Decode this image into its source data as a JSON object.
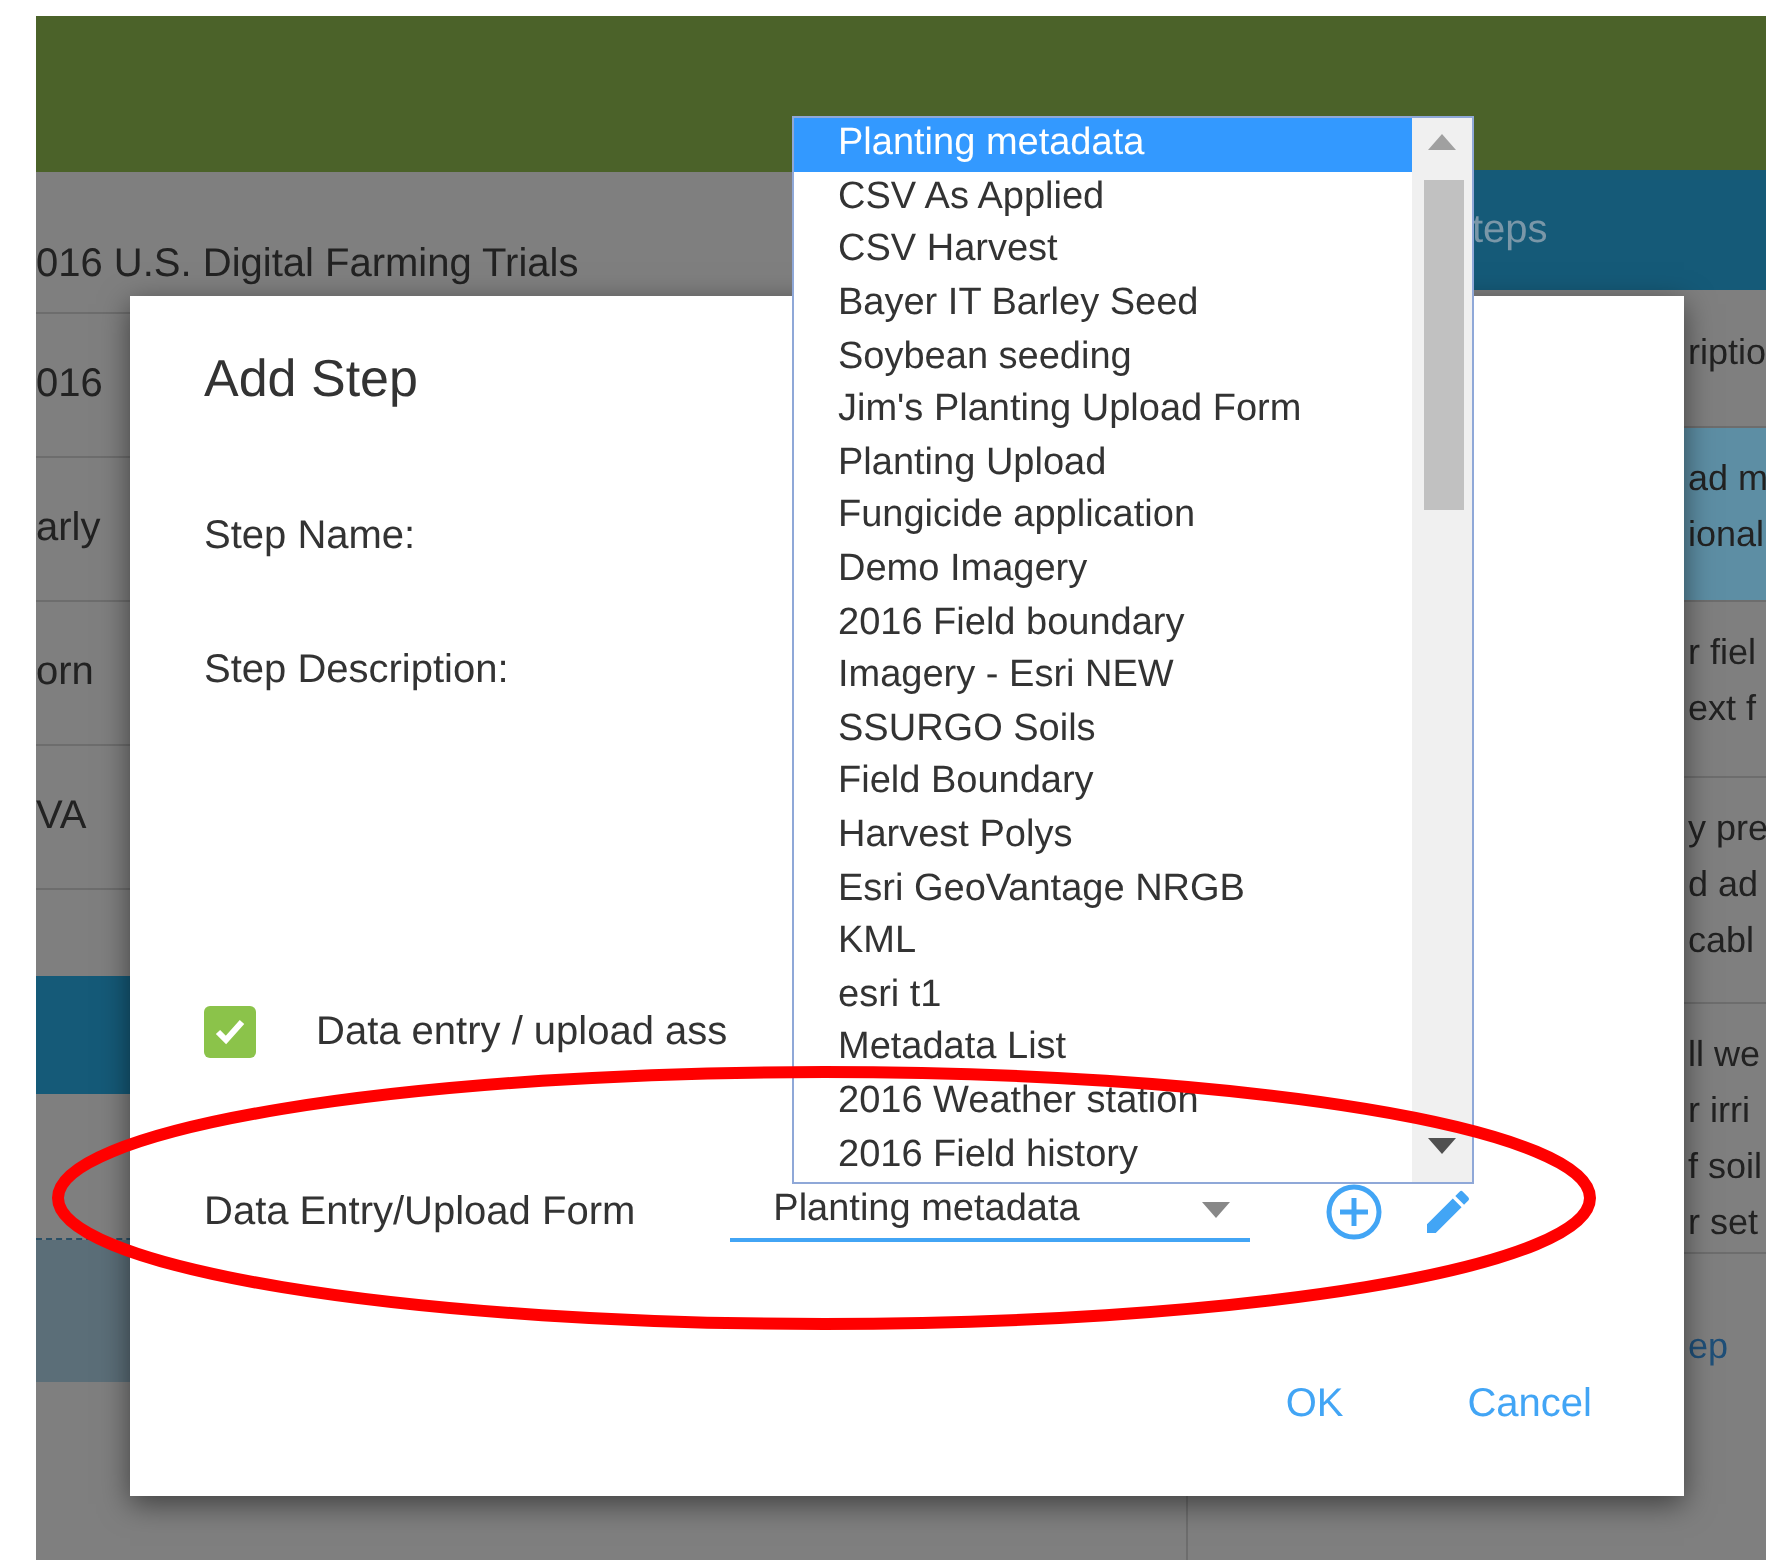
{
  "background_page": {
    "left_panel": {
      "title": "016 U.S. Digital Farming Trials",
      "rows": [
        "016",
        "arly",
        "orn",
        "VA"
      ]
    },
    "right_panel": {
      "header": "teps",
      "rows": [
        {
          "lines": [
            "riptio"
          ],
          "highlighted": false
        },
        {
          "lines": [
            "ad m",
            "ional"
          ],
          "highlighted": true
        },
        {
          "lines": [
            "r fiel",
            "ext f"
          ],
          "highlighted": false
        },
        {
          "lines": [
            "y pre",
            "d ad",
            "cabl"
          ],
          "highlighted": false
        },
        {
          "lines": [
            "ll we",
            "r irri",
            "f soil",
            "r set"
          ],
          "highlighted": false
        }
      ],
      "link": "ep"
    }
  },
  "dialog": {
    "title": "Add Step",
    "fields": [
      {
        "label": "Step Name:"
      },
      {
        "label": "Step Description:"
      }
    ],
    "checkbox": {
      "label": "Data entry / upload ass",
      "checked": true
    },
    "form_select": {
      "label": "Data Entry/Upload Form",
      "value": "Planting metadata"
    },
    "buttons": [
      "OK",
      "Cancel"
    ]
  },
  "dropdown": {
    "options": [
      {
        "label": "Planting metadata",
        "selected": true
      },
      {
        "label": "CSV As Applied",
        "selected": false
      },
      {
        "label": "CSV Harvest",
        "selected": false
      },
      {
        "label": "Bayer IT Barley Seed",
        "selected": false
      },
      {
        "label": "Soybean seeding",
        "selected": false
      },
      {
        "label": "Jim's Planting Upload Form",
        "selected": false
      },
      {
        "label": "Planting Upload",
        "selected": false
      },
      {
        "label": "Fungicide application",
        "selected": false
      },
      {
        "label": "Demo Imagery",
        "selected": false
      },
      {
        "label": "2016 Field boundary",
        "selected": false
      },
      {
        "label": "Imagery - Esri NEW",
        "selected": false
      },
      {
        "label": "SSURGO Soils",
        "selected": false
      },
      {
        "label": "Field Boundary",
        "selected": false
      },
      {
        "label": "Harvest Polys",
        "selected": false
      },
      {
        "label": "Esri GeoVantage NRGB",
        "selected": false
      },
      {
        "label": "KML",
        "selected": false
      },
      {
        "label": "esri t1",
        "selected": false
      },
      {
        "label": "Metadata List",
        "selected": false
      },
      {
        "label": "2016 Weather station",
        "selected": false
      },
      {
        "label": "2016 Field history",
        "selected": false
      }
    ]
  }
}
